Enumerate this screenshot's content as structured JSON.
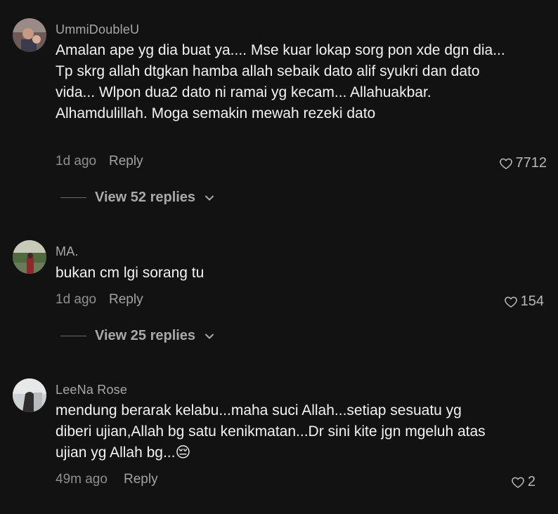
{
  "comments": [
    {
      "username": "UmmiDoubleU",
      "text": "Amalan ape yg dia buat ya.... Mse kuar lokap sorg pon xde dgn dia... Tp skrg allah dtgkan hamba allah sebaik dato alif syukri dan dato vida... Wlpon dua2 dato ni ramai yg kecam... Allahuakbar. Alhamdulillah. Moga semakin mewah rezeki dato",
      "time": "1d ago",
      "reply": "Reply",
      "likes": "7712",
      "view_replies": "View 52 replies"
    },
    {
      "username": "MA.",
      "text": "bukan cm lgi sorang tu",
      "time": "1d ago",
      "reply": "Reply",
      "likes": "154",
      "view_replies": "View 25 replies"
    },
    {
      "username": "LeeNa Rose",
      "text": "mendung berarak kelabu...maha suci Allah...setiap sesuatu yg diberi ujian,Allah bg satu kenikmatan...Dr sini kite jgn mgeluh atas ujian yg Allah bg...😔",
      "time": "49m ago",
      "reply": "Reply",
      "likes": "2"
    }
  ],
  "icons": {
    "heart": "heart-outline-icon",
    "chevron": "chevron-down-icon"
  }
}
